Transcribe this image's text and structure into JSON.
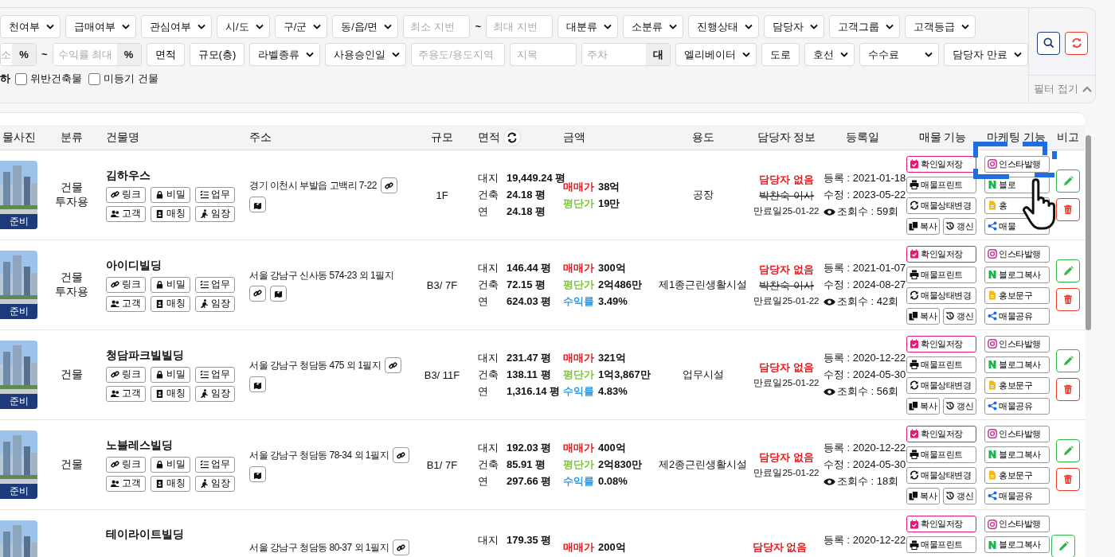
{
  "filters": {
    "lines": [
      {
        "items": [
          {
            "kind": "select",
            "label": "천여부"
          },
          {
            "kind": "select",
            "label": "급매여부"
          },
          {
            "kind": "select",
            "label": "관심여부"
          },
          {
            "kind": "select",
            "label": "시/도"
          },
          {
            "kind": "select",
            "label": "구/군"
          },
          {
            "kind": "select",
            "label": "동/읍/면"
          },
          {
            "kind": "input",
            "placeholder": "최소 지번"
          },
          {
            "kind": "sep",
            "label": "~"
          },
          {
            "kind": "input",
            "placeholder": "최대 지번"
          },
          {
            "kind": "select",
            "label": "대분류"
          },
          {
            "kind": "select",
            "label": "소분류"
          },
          {
            "kind": "select",
            "label": "진행상태"
          },
          {
            "kind": "select",
            "label": "담당자"
          },
          {
            "kind": "select",
            "label": "고객그룹"
          },
          {
            "kind": "select",
            "label": "고객등급"
          }
        ]
      },
      {
        "items": [
          {
            "kind": "input",
            "placeholder": "소",
            "addon": "%"
          },
          {
            "kind": "sep",
            "label": "~"
          },
          {
            "kind": "input",
            "placeholder": "수익률 최대",
            "addon": "%"
          },
          {
            "kind": "button",
            "label": "면적"
          },
          {
            "kind": "button",
            "label": "규모(층)"
          },
          {
            "kind": "select",
            "label": "라벨종류"
          },
          {
            "kind": "select",
            "label": "사용승인일"
          },
          {
            "kind": "input",
            "placeholder": "주용도/용도지역"
          },
          {
            "kind": "input",
            "placeholder": "지목"
          },
          {
            "kind": "input",
            "placeholder": "주차",
            "addon": "대"
          },
          {
            "kind": "select",
            "label": "엘리베이터"
          },
          {
            "kind": "button",
            "label": "도로"
          },
          {
            "kind": "select",
            "label": "호선"
          },
          {
            "kind": "select",
            "label": "수수료"
          },
          {
            "kind": "select",
            "label": "담당자 만료"
          }
        ]
      },
      {
        "items": [
          {
            "kind": "text",
            "label": "하"
          },
          {
            "kind": "checkbox",
            "label": "위반건축물",
            "checked": false
          },
          {
            "kind": "checkbox",
            "label": "미등기 건물",
            "checked": false
          }
        ]
      }
    ],
    "collapse": "필터 접기"
  },
  "table": {
    "columns": [
      "물사진",
      "분류",
      "건물명",
      "주소",
      "규모",
      "면적",
      "금액",
      "용도",
      "담당자 정보",
      "등록일",
      "매물 기능",
      "마케팅 기능",
      "비고"
    ],
    "rows": [
      {
        "status": "준비",
        "category": "건물 투자용",
        "name": "김하우스",
        "tags": [
          {
            "kind": "link",
            "label": "링크"
          },
          {
            "kind": "secret",
            "label": "비밀"
          },
          {
            "kind": "task",
            "label": "업무"
          },
          {
            "kind": "client",
            "label": "고객"
          },
          {
            "kind": "match",
            "label": "매칭"
          },
          {
            "kind": "visit",
            "label": "임장"
          }
        ],
        "address": "경기 이천시 부발읍 고백리 7-22",
        "links": [
          {
            "kind": "link"
          },
          {
            "kind": "map"
          }
        ],
        "scale": "1F",
        "areas": [
          {
            "label": "대지",
            "value": "19,449.24 평"
          },
          {
            "label": "건축",
            "value": "24.18 평"
          },
          {
            "label": "연",
            "value": "24.18 평"
          }
        ],
        "prices": [
          {
            "kind": "sale",
            "label": "매매가",
            "value": "38억"
          },
          {
            "kind": "unit",
            "label": "평단가",
            "value": "19만"
          }
        ],
        "use": "공장",
        "manager": {
          "status": "담당자 없음",
          "former": "박찬숙 이사",
          "expiry": "만료일25-01-22"
        },
        "dates": [
          {
            "kind": "text",
            "text": "등록 : 2021-01-18"
          },
          {
            "kind": "text",
            "text": "수정 : 2023-05-22"
          },
          {
            "kind": "views",
            "text": "조회수 : 59회"
          }
        ],
        "functions": [
          {
            "kind": "confirm",
            "label": "확인일저장"
          },
          {
            "kind": "print",
            "label": "매물프린트"
          },
          {
            "kind": "status",
            "label": "매물상태변경"
          },
          {
            "kind": "copy",
            "label": "복사"
          },
          {
            "kind": "renew",
            "label": "갱신"
          }
        ],
        "marketing": [
          {
            "kind": "insta",
            "label": "인스타발행"
          },
          {
            "kind": "blog",
            "label": "블로"
          },
          {
            "kind": "promo",
            "label": "홍"
          },
          {
            "kind": "share",
            "label": "매물"
          }
        ],
        "actions": [
          {
            "kind": "edit"
          },
          {
            "kind": "delete"
          }
        ]
      },
      {
        "status": "준비",
        "category": "건물 투자용",
        "name": "아이디빌딩",
        "tags": [
          {
            "kind": "link",
            "label": "링크"
          },
          {
            "kind": "secret",
            "label": "비밀"
          },
          {
            "kind": "task",
            "label": "업무"
          },
          {
            "kind": "client",
            "label": "고객"
          },
          {
            "kind": "match",
            "label": "매칭"
          },
          {
            "kind": "visit",
            "label": "임장"
          }
        ],
        "address": "서울 강남구 신사동 574-23 외 1필지",
        "links": [
          {
            "kind": "link"
          },
          {
            "kind": "map"
          }
        ],
        "scale": "B3/ 7F",
        "areas": [
          {
            "label": "대지",
            "value": "146.44 평"
          },
          {
            "label": "건축",
            "value": "72.15 평"
          },
          {
            "label": "연",
            "value": "624.03 평"
          }
        ],
        "prices": [
          {
            "kind": "sale",
            "label": "매매가",
            "value": "300억"
          },
          {
            "kind": "unit",
            "label": "평단가",
            "value": "2억486만"
          },
          {
            "kind": "yield",
            "label": "수익률",
            "value": "3.49%"
          }
        ],
        "use": "제1종근린생활시설",
        "manager": {
          "status": "담당자 없음",
          "former": "박찬숙 이사",
          "expiry": "만료일25-01-22"
        },
        "dates": [
          {
            "kind": "text",
            "text": "등록 : 2021-01-07"
          },
          {
            "kind": "text",
            "text": "수정 : 2024-08-27"
          },
          {
            "kind": "views",
            "text": "조회수 : 42회"
          }
        ],
        "functions": [
          {
            "kind": "confirm",
            "label": "확인일저장"
          },
          {
            "kind": "print",
            "label": "매물프린트"
          },
          {
            "kind": "status",
            "label": "매물상태변경"
          },
          {
            "kind": "copy",
            "label": "복사"
          },
          {
            "kind": "renew",
            "label": "갱신"
          }
        ],
        "marketing": [
          {
            "kind": "insta",
            "label": "인스타발행"
          },
          {
            "kind": "blog",
            "label": "블로그복사"
          },
          {
            "kind": "promo",
            "label": "홍보문구"
          },
          {
            "kind": "share",
            "label": "매물공유"
          }
        ],
        "actions": [
          {
            "kind": "edit"
          },
          {
            "kind": "delete"
          }
        ]
      },
      {
        "status": "준비",
        "category": "건물",
        "name": "청담파크빌빌딩",
        "tags": [
          {
            "kind": "link",
            "label": "링크"
          },
          {
            "kind": "secret",
            "label": "비밀"
          },
          {
            "kind": "task",
            "label": "업무"
          },
          {
            "kind": "client",
            "label": "고객"
          },
          {
            "kind": "match",
            "label": "매칭"
          },
          {
            "kind": "visit",
            "label": "임장"
          }
        ],
        "address": "서울 강남구 청담동 475 외 1필지",
        "links": [
          {
            "kind": "link"
          },
          {
            "kind": "map"
          }
        ],
        "scale": "B3/ 11F",
        "areas": [
          {
            "label": "대지",
            "value": "231.47 평"
          },
          {
            "label": "건축",
            "value": "138.11 평"
          },
          {
            "label": "연",
            "value": "1,316.14 평"
          }
        ],
        "prices": [
          {
            "kind": "sale",
            "label": "매매가",
            "value": "321억"
          },
          {
            "kind": "unit",
            "label": "평단가",
            "value": "1억3,867만"
          },
          {
            "kind": "yield",
            "label": "수익률",
            "value": "4.83%"
          }
        ],
        "use": "업무시설",
        "manager": {
          "status": "담당자 없음",
          "expiry": "만료일25-01-22"
        },
        "dates": [
          {
            "kind": "text",
            "text": "등록 : 2020-12-22"
          },
          {
            "kind": "text",
            "text": "수정 : 2024-05-30"
          },
          {
            "kind": "views",
            "text": "조회수 : 56회"
          }
        ],
        "functions": [
          {
            "kind": "confirm",
            "label": "확인일저장"
          },
          {
            "kind": "print",
            "label": "매물프린트"
          },
          {
            "kind": "status",
            "label": "매물상태변경"
          },
          {
            "kind": "copy",
            "label": "복사"
          },
          {
            "kind": "renew",
            "label": "갱신"
          }
        ],
        "marketing": [
          {
            "kind": "insta",
            "label": "인스타발행"
          },
          {
            "kind": "blog",
            "label": "블로그복사"
          },
          {
            "kind": "promo",
            "label": "홍보문구"
          },
          {
            "kind": "share",
            "label": "매물공유"
          }
        ],
        "actions": [
          {
            "kind": "edit"
          },
          {
            "kind": "delete"
          }
        ]
      },
      {
        "status": "준비",
        "category": "건물",
        "name": "노블레스빌딩",
        "tags": [
          {
            "kind": "link",
            "label": "링크"
          },
          {
            "kind": "secret",
            "label": "비밀"
          },
          {
            "kind": "task",
            "label": "업무"
          },
          {
            "kind": "client",
            "label": "고객"
          },
          {
            "kind": "match",
            "label": "매칭"
          },
          {
            "kind": "visit",
            "label": "임장"
          }
        ],
        "address": "서울 강남구 청담동 78-34 외 1필지",
        "links": [
          {
            "kind": "link"
          },
          {
            "kind": "map"
          }
        ],
        "scale": "B1/ 7F",
        "areas": [
          {
            "label": "대지",
            "value": "192.03 평"
          },
          {
            "label": "건축",
            "value": "85.91 평"
          },
          {
            "label": "연",
            "value": "297.66 평"
          }
        ],
        "prices": [
          {
            "kind": "sale",
            "label": "매매가",
            "value": "400억"
          },
          {
            "kind": "unit",
            "label": "평단가",
            "value": "2억830만"
          },
          {
            "kind": "yield",
            "label": "수익률",
            "value": "0.08%"
          }
        ],
        "use": "제2종근린생활시설",
        "manager": {
          "status": "담당자 없음",
          "expiry": "만료일25-01-22"
        },
        "dates": [
          {
            "kind": "text",
            "text": "등록 : 2020-12-22"
          },
          {
            "kind": "text",
            "text": "수정 : 2024-05-30"
          },
          {
            "kind": "views",
            "text": "조회수 : 18회"
          }
        ],
        "functions": [
          {
            "kind": "confirm",
            "label": "확인일저장"
          },
          {
            "kind": "print",
            "label": "매물프린트"
          },
          {
            "kind": "status",
            "label": "매물상태변경"
          },
          {
            "kind": "copy",
            "label": "복사"
          },
          {
            "kind": "renew",
            "label": "갱신"
          }
        ],
        "marketing": [
          {
            "kind": "insta",
            "label": "인스타발행"
          },
          {
            "kind": "blog",
            "label": "블로그복사"
          },
          {
            "kind": "promo",
            "label": "홍보문구"
          },
          {
            "kind": "share",
            "label": "매물공유"
          }
        ],
        "actions": [
          {
            "kind": "edit"
          },
          {
            "kind": "delete"
          }
        ]
      },
      {
        "name": "테이라이트빌딩",
        "address": "서울 강남구 청담동 80-37 외 1필지",
        "links": [
          {
            "kind": "link"
          }
        ],
        "areas": [
          {
            "label": "대지",
            "value": "179.35 평"
          }
        ],
        "prices": [
          {
            "kind": "sale",
            "label": "매매가",
            "value": "200억"
          }
        ],
        "manager": {
          "status": "담당자 없음"
        },
        "dates": [
          {
            "kind": "text",
            "text": "등록 : 2020-12-22"
          }
        ],
        "functions": [
          {
            "kind": "confirm",
            "label": "확인일저장"
          },
          {
            "kind": "print",
            "label": "매물프린트"
          }
        ],
        "marketing": [
          {
            "kind": "insta",
            "label": "인스타발행"
          },
          {
            "kind": "blog",
            "label": "블로그복사"
          }
        ],
        "actions": [
          {
            "kind": "edit"
          }
        ]
      }
    ]
  }
}
